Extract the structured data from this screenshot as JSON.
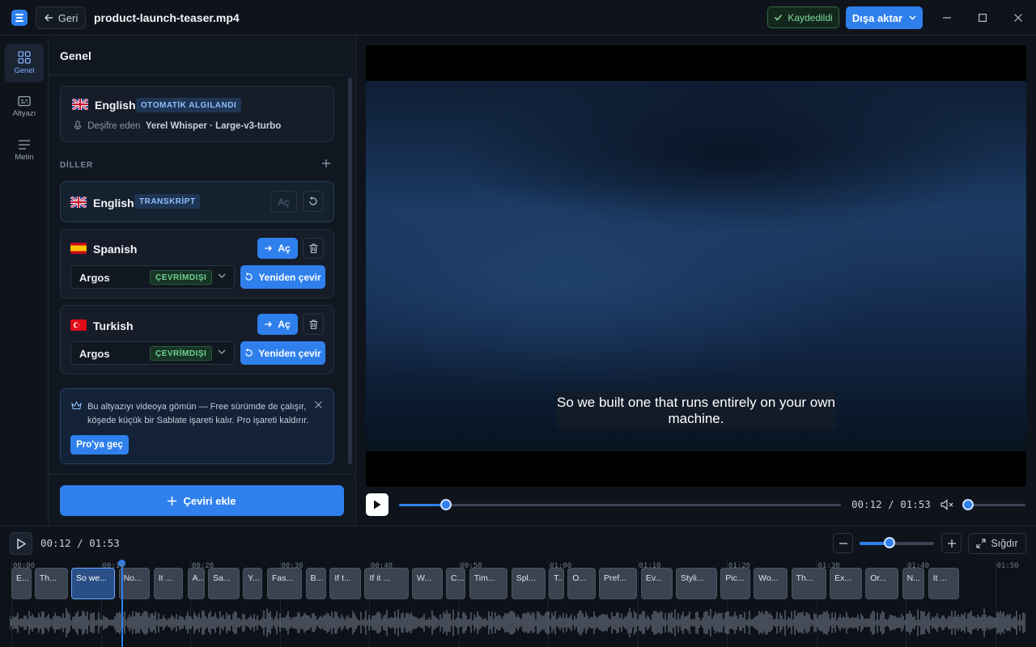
{
  "titlebar": {
    "back_label": "Geri",
    "file_name": "product-launch-teaser.mp4",
    "saved_label": "Kaydedildi",
    "export_label": "Dışa aktar"
  },
  "rail": [
    {
      "label": "Genel",
      "icon": "grid-icon",
      "active": true
    },
    {
      "label": "Altyazı",
      "icon": "subtitles-icon",
      "active": false
    },
    {
      "label": "Metin",
      "icon": "text-lines-icon",
      "active": false
    }
  ],
  "panel": {
    "title": "Genel",
    "source": {
      "language": "English",
      "badge": "OTOMATİK ALGILANDI",
      "meta_prefix": "Deşifre eden",
      "meta_value": "Yerel Whisper · Large-v3-turbo"
    },
    "languages_label": "DİLLER",
    "languages": [
      {
        "name": "English",
        "badge": "TRANSKRİPT",
        "open_label": "Aç"
      },
      {
        "name": "Spanish",
        "open_label": "Aç",
        "engine": "Argos",
        "engine_badge": "ÇEVRİMDIŞI",
        "retranslate_label": "Yeniden çevir"
      },
      {
        "name": "Turkish",
        "open_label": "Aç",
        "engine": "Argos",
        "engine_badge": "ÇEVRİMDIŞI",
        "retranslate_label": "Yeniden çevir"
      }
    ],
    "promo": {
      "text": "Bu altyazıyı videoya gömün — Free sürümde de çalışır, köşede küçük bir Sablate işareti kalır. Pro işareti kaldırır.",
      "button": "Pro'ya geç"
    },
    "add_translation_label": "Çeviri ekle"
  },
  "player": {
    "subtitle": "So we built one that runs entirely on your own machine.",
    "current_time": "00:12",
    "duration": "01:53",
    "time_display": "00:12 / 01:53",
    "progress": 0.106,
    "volume": 0.0
  },
  "timeline": {
    "time_display": "00:12 / 01:53",
    "fit_label": "Sığdır",
    "zoom_level": 0.4,
    "ticks": [
      "00:00",
      "00:10",
      "00:20",
      "00:30",
      "00:40",
      "00:50",
      "01:00",
      "01:10",
      "01:20",
      "01:30",
      "01:40",
      "01:50"
    ],
    "segments": [
      {
        "text": "E...",
        "start": 0.0,
        "end": 2.3
      },
      {
        "text": "Th...",
        "start": 2.6,
        "end": 6.3
      },
      {
        "text": "So we...",
        "start": 6.7,
        "end": 11.6,
        "active": true
      },
      {
        "text": "No...",
        "start": 12.0,
        "end": 15.5
      },
      {
        "text": "It ...",
        "start": 15.9,
        "end": 19.2
      },
      {
        "text": "A...",
        "start": 19.7,
        "end": 21.6
      },
      {
        "text": "Sa...",
        "start": 22.0,
        "end": 25.5
      },
      {
        "text": "Y...",
        "start": 25.9,
        "end": 28.1
      },
      {
        "text": "Fas...",
        "start": 28.6,
        "end": 32.5
      },
      {
        "text": "B...",
        "start": 32.9,
        "end": 35.2
      },
      {
        "text": "If t...",
        "start": 35.6,
        "end": 39.1
      },
      {
        "text": "If it ...",
        "start": 39.5,
        "end": 44.4
      },
      {
        "text": "W...",
        "start": 44.8,
        "end": 48.2
      },
      {
        "text": "C...",
        "start": 48.6,
        "end": 50.8
      },
      {
        "text": "Tim...",
        "start": 51.2,
        "end": 55.5
      },
      {
        "text": "Spl...",
        "start": 55.9,
        "end": 59.7
      },
      {
        "text": "T...",
        "start": 60.1,
        "end": 61.8
      },
      {
        "text": "O...",
        "start": 62.2,
        "end": 65.3
      },
      {
        "text": "Pref...",
        "start": 65.7,
        "end": 70.0
      },
      {
        "text": "Ev...",
        "start": 70.4,
        "end": 73.9
      },
      {
        "text": "Styli...",
        "start": 74.3,
        "end": 78.9
      },
      {
        "text": "Pic...",
        "start": 79.3,
        "end": 82.6
      },
      {
        "text": "Wo...",
        "start": 83.0,
        "end": 86.8
      },
      {
        "text": "Th...",
        "start": 87.2,
        "end": 91.1
      },
      {
        "text": "Ex...",
        "start": 91.5,
        "end": 95.1
      },
      {
        "text": "Or...",
        "start": 95.5,
        "end": 99.2
      },
      {
        "text": "N...",
        "start": 99.6,
        "end": 102.1
      },
      {
        "text": "It ...",
        "start": 102.5,
        "end": 106.0
      }
    ]
  },
  "colors": {
    "accent": "#2f80ed",
    "saved_green": "#7fd89a",
    "offline_green": "#6fd494",
    "background": "#0f141c"
  }
}
